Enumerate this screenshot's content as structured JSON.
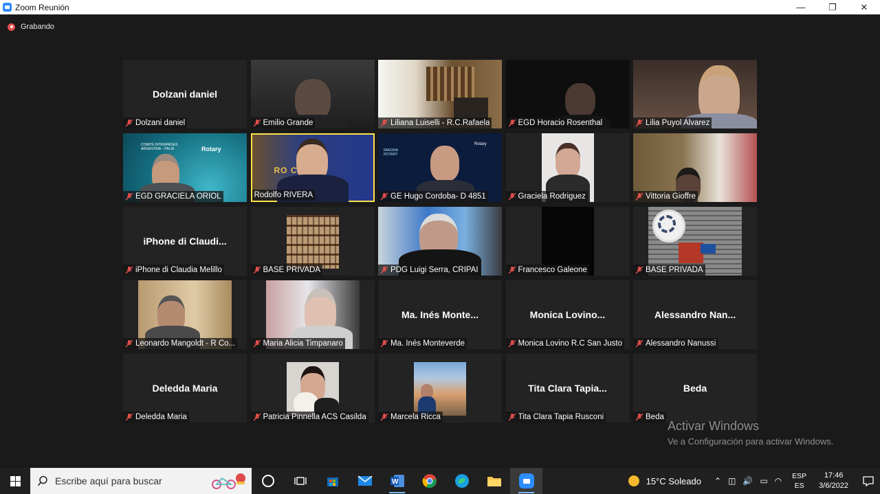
{
  "window": {
    "title": "Zoom Reunión",
    "minimize": "—",
    "maximize": "❐",
    "close": "✕"
  },
  "recording": {
    "label": "Grabando"
  },
  "participants": [
    {
      "name": "Dolzani daniel",
      "display": "Dolzani daniel",
      "video": false
    },
    {
      "name": "Emilio Grande",
      "video": true
    },
    {
      "name": "Liliana Luiselli - R.C.Rafaela",
      "video": true
    },
    {
      "name": "EGD Horacio Rosenthal",
      "video": true
    },
    {
      "name": "Lilia Puyol Alvarez",
      "video": true
    },
    {
      "name": "EGD GRACIELA ORIOL",
      "video": true
    },
    {
      "name": "Rodolfo RIVERA",
      "video": true,
      "active": true
    },
    {
      "name": "GE Hugo Cordoba- D 4851",
      "video": true
    },
    {
      "name": "Graciela Rodriguez",
      "video": true
    },
    {
      "name": "Vittoria Gioffre",
      "video": true
    },
    {
      "name": "iPhone di Claudia Melillo",
      "display": "iPhone di Claudi...",
      "video": false
    },
    {
      "name": "BASE PRIVADA",
      "video": true
    },
    {
      "name": "PDG Luigi Serra, CRIPAI",
      "video": true
    },
    {
      "name": "Francesco Galeone",
      "video": true
    },
    {
      "name": "BASE PRIVADA",
      "video": true
    },
    {
      "name": "Leonardo Mangoldt - R Co...",
      "video": true
    },
    {
      "name": "Maria Alicia Timpanaro",
      "video": true
    },
    {
      "name": "Ma. Inés Monteverde",
      "display": "Ma. Inés Monte...",
      "video": false
    },
    {
      "name": "Monica Lovino R.C San Justo",
      "display": "Monica Lovino...",
      "video": false
    },
    {
      "name": "Alessandro Nanussi",
      "display": "Alessandro Nan...",
      "video": false
    },
    {
      "name": "Deledda Maria",
      "display": "Deledda Maria",
      "video": false
    },
    {
      "name": "Patricia Pinnella ACS Casilda",
      "video": true
    },
    {
      "name": "Marcela Ricca",
      "video": true
    },
    {
      "name": "Tita Clara Tapia Rusconi",
      "display": "Tita Clara Tapia...",
      "video": false
    },
    {
      "name": "Beda",
      "display": "Beda",
      "video": false
    }
  ],
  "video_text": {
    "oriol_left": "COMITÉ INTERPAÍSES ARGENTINA - ITALIA",
    "oriol_right": "Rotary",
    "rivera_banner": "RO  CLUB",
    "hugo_logo": "IMAGINA ROTARY",
    "hugo_right": "Rotary"
  },
  "activation": {
    "title": "Activar Windows",
    "subtitle": "Ve a Configuración para activar Windows."
  },
  "taskbar": {
    "search_placeholder": "Escribe aquí para buscar",
    "weather": "15°C  Soleado",
    "lang_top": "ESP",
    "lang_bottom": "ES",
    "time": "17:46",
    "date": "3/6/2022"
  },
  "colors": {
    "accent_zoom": "#2d8cff",
    "active_speaker": "#ffe34d",
    "muted": "#e2504d"
  }
}
